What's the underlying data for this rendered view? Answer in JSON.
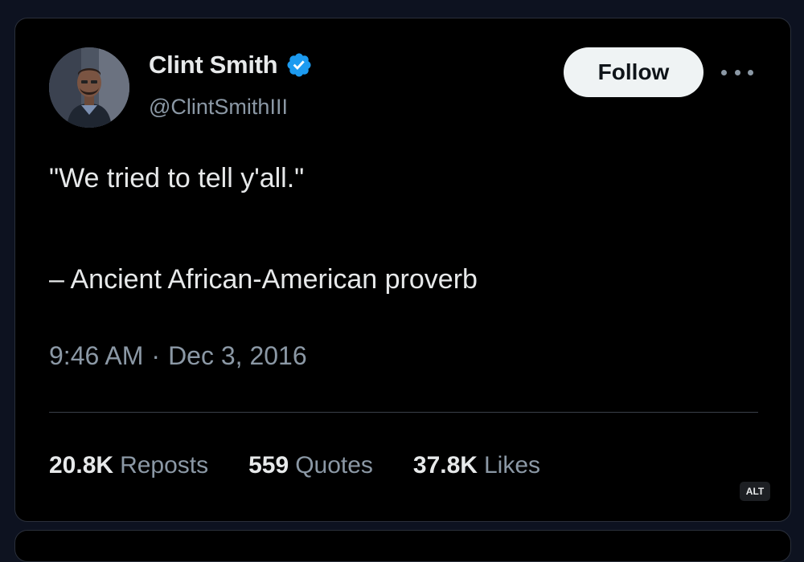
{
  "tweet": {
    "author": {
      "name": "Clint Smith",
      "handle": "@ClintSmithIII",
      "verified": true,
      "verified_color": "#1d9bf0"
    },
    "follow_label": "Follow",
    "text_line1": "\"We tried to tell y'all.\"",
    "text_line2": "– Ancient African-American proverb",
    "time": "9:46 AM",
    "separator": "·",
    "date": "Dec 3, 2016",
    "stats": [
      {
        "count": "20.8K",
        "label": "Reposts"
      },
      {
        "count": "559",
        "label": "Quotes"
      },
      {
        "count": "37.8K",
        "label": "Likes"
      }
    ]
  },
  "alt_badge": "ALT",
  "icons": {
    "more": "more-horizontal-icon",
    "verified": "verified-badge-icon"
  },
  "colors": {
    "background": "#000000",
    "text_primary": "#e7e9ea",
    "text_secondary": "#8b98a5",
    "follow_bg": "#eff3f4"
  }
}
